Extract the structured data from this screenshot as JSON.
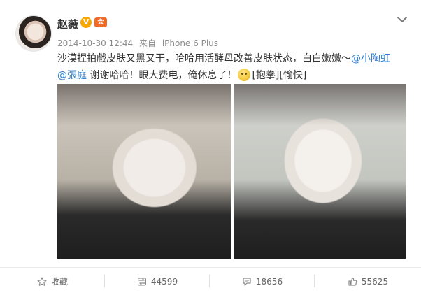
{
  "post": {
    "username": "赵薇",
    "verify_mark": "V",
    "vip_mark": "会",
    "timestamp": "2014-10-30 12:44",
    "source_prefix": "来自",
    "source": "iPhone 6 Plus",
    "text_before": "沙漠捏拍戲皮肤又黑又干，哈哈用活酵母改善皮肤状态，白白嫩嫩～",
    "mention1": "@小陶虹",
    "mention2": "@張庭",
    "text_after": " 谢谢哈哈！眼大费电，俺休息了！",
    "tags": "[抱拳][愉快]"
  },
  "actions": {
    "favorite": "收藏",
    "repost_count": "44599",
    "comment_count": "18656",
    "like_count": "55625"
  },
  "icons": {
    "dropdown": "chevron-down-icon",
    "favorite": "star-icon",
    "repost": "repost-icon",
    "comment": "comment-icon",
    "like": "thumbs-up-icon"
  }
}
